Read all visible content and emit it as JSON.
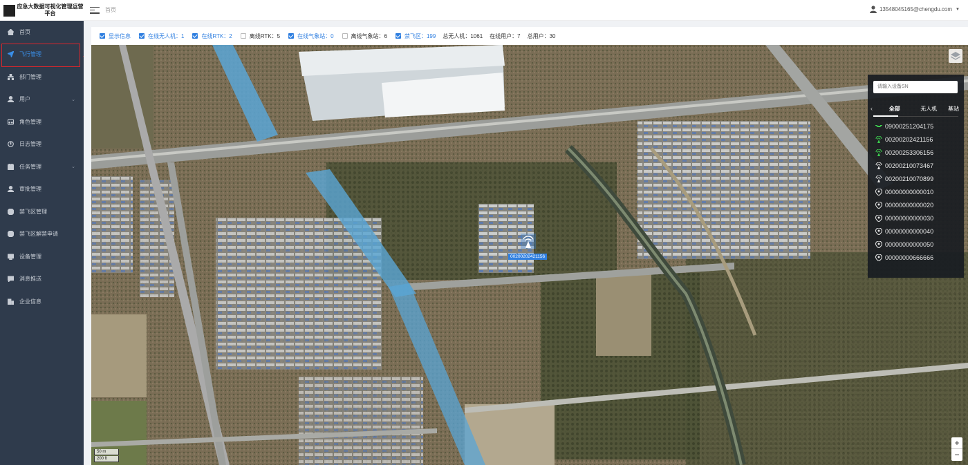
{
  "app": {
    "title": "应急大数据可视化管理运营平台"
  },
  "header": {
    "breadcrumb": "首页",
    "user_email": "13548045165@chengdu.com"
  },
  "sidebar": {
    "items": [
      {
        "label": "首页",
        "icon": "home-icon",
        "active": false,
        "has_submenu": false
      },
      {
        "label": "飞行管理",
        "icon": "send-icon",
        "active": true,
        "has_submenu": false
      },
      {
        "label": "部门管理",
        "icon": "org-icon",
        "active": false,
        "has_submenu": false
      },
      {
        "label": "用户",
        "icon": "user-icon",
        "active": false,
        "has_submenu": true
      },
      {
        "label": "角色管理",
        "icon": "role-icon",
        "active": false,
        "has_submenu": false
      },
      {
        "label": "日志管理",
        "icon": "log-icon",
        "active": false,
        "has_submenu": false
      },
      {
        "label": "任务管理",
        "icon": "task-icon",
        "active": false,
        "has_submenu": true
      },
      {
        "label": "审批管理",
        "icon": "approve-icon",
        "active": false,
        "has_submenu": false
      },
      {
        "label": "禁飞区管理",
        "icon": "nofly-icon",
        "active": false,
        "has_submenu": false
      },
      {
        "label": "禁飞区解禁申请",
        "icon": "unlock-icon",
        "active": false,
        "has_submenu": false
      },
      {
        "label": "设备管理",
        "icon": "device-icon",
        "active": false,
        "has_submenu": false
      },
      {
        "label": "消息推送",
        "icon": "message-icon",
        "active": false,
        "has_submenu": false
      },
      {
        "label": "企业信息",
        "icon": "company-icon",
        "active": false,
        "has_submenu": false
      }
    ]
  },
  "filters": {
    "show_info": "显示信息",
    "online_drones": "在线无人机：1",
    "online_rtk": "在线RTK：2",
    "offline_rtk": "离线RTK：5",
    "online_weather": "在线气象站：0",
    "offline_weather": "离线气象站：6",
    "no_fly": "禁飞区：199",
    "total_drones": "总无人机：1061",
    "online_users": "在线用户：7",
    "total_users": "总用户：30"
  },
  "map": {
    "marker_label": "00200202421156",
    "scale_top": "50 m",
    "scale_bottom": "200 ft",
    "zoom_in": "+",
    "zoom_out": "−"
  },
  "device_panel": {
    "search_placeholder": "请输入设备SN",
    "tabs": [
      "全部",
      "无人机",
      "基站"
    ],
    "devices": [
      {
        "sn": "09000251204175",
        "type": "drone",
        "status": "online"
      },
      {
        "sn": "00200202421156",
        "type": "rtk",
        "status": "online"
      },
      {
        "sn": "00200253306156",
        "type": "rtk",
        "status": "online"
      },
      {
        "sn": "00200210073467",
        "type": "rtk",
        "status": "offline"
      },
      {
        "sn": "00200210070899",
        "type": "rtk",
        "status": "offline"
      },
      {
        "sn": "00000000000010",
        "type": "weather",
        "status": "offline"
      },
      {
        "sn": "00000000000020",
        "type": "weather",
        "status": "offline"
      },
      {
        "sn": "00000000000030",
        "type": "weather",
        "status": "offline"
      },
      {
        "sn": "00000000000040",
        "type": "weather",
        "status": "offline"
      },
      {
        "sn": "00000000000050",
        "type": "weather",
        "status": "offline"
      },
      {
        "sn": "00000000666666",
        "type": "weather",
        "status": "offline"
      }
    ]
  },
  "colors": {
    "sidebar_bg": "#2f3b4c",
    "accent": "#2f7fe0",
    "online_green": "#3ccf4e",
    "highlight_red": "#d9262c"
  }
}
